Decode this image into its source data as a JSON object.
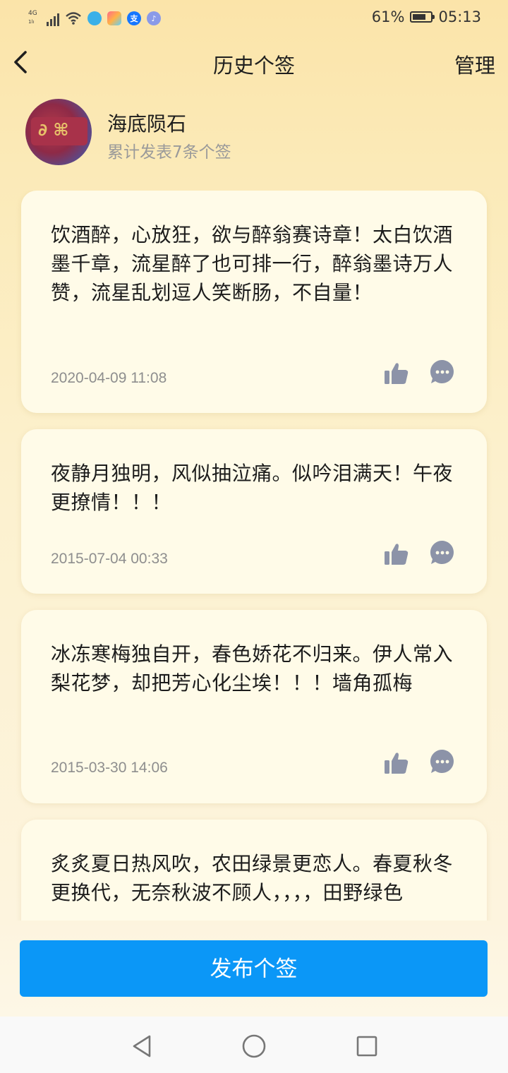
{
  "status_bar": {
    "network": "4G",
    "network_sub": "1lı",
    "battery_text": "61%",
    "battery_level": 0.61,
    "time": "05:13",
    "app_icons": [
      "qq-browser-icon",
      "gallery-icon",
      "alipay-icon",
      "music-icon"
    ],
    "alipay_glyph": "支"
  },
  "header": {
    "title": "历史个签",
    "manage_label": "管理"
  },
  "profile": {
    "name": "海底陨石",
    "count_text": "累计发表7条个签"
  },
  "cards": [
    {
      "text": "饮酒醉，心放狂，欲与醉翁赛诗章！太白饮酒墨千章，流星醉了也可排一行，醉翁墨诗万人赞，流星乱划逗人笑断肠，不自量！",
      "date": "2020-04-09 11:08"
    },
    {
      "text": "夜静月独明，风似抽泣痛。似吟泪满天！午夜更撩情！！！",
      "date": "2015-07-04 00:33"
    },
    {
      "text": "冰冻寒梅独自开，春色娇花不归来。伊人常入梨花梦，却把芳心化尘埃！！！墙角孤梅",
      "date": "2015-03-30 14:06"
    },
    {
      "text": "炙炙夏日热风吹，农田绿景更恋人。春夏秋冬更换代，无奈秋波不顾人，，，，田野绿色",
      "date": ""
    }
  ],
  "publish_button": "发布个签",
  "colors": {
    "accent": "#0b97f7",
    "card_bg": "#fffbe8",
    "icon": "#8c93a8",
    "date_text": "#8e8e8e"
  }
}
